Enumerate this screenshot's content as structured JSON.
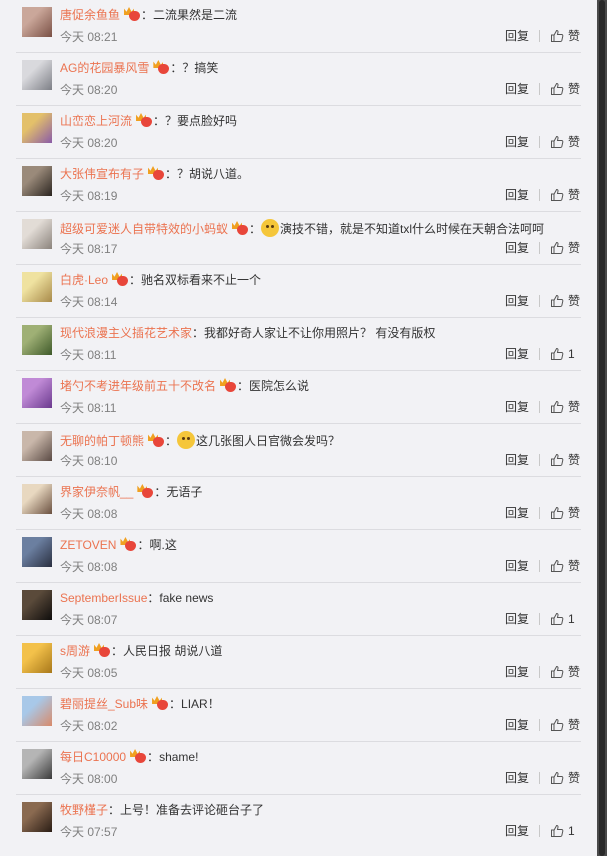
{
  "ui": {
    "colors": {
      "username": "#eb7350",
      "time": "#808080",
      "panel_bg": "#f2f2f5",
      "divider": "#dcdce0"
    }
  },
  "comments": [
    {
      "user": "唐促余鱼鱼",
      "vip": true,
      "emoji": false,
      "text": "二流果然是二流",
      "time": "今天 08:21",
      "reply": "回复",
      "like": "赞",
      "avatar": [
        "#caa79a",
        "#7a5045"
      ]
    },
    {
      "user": "AG的花园暴风雪",
      "vip": true,
      "emoji": false,
      "text": "？搞笑",
      "time": "今天 08:20",
      "reply": "回复",
      "like": "赞",
      "avatar": [
        "#d9d9dd",
        "#7d7f86"
      ]
    },
    {
      "user": "山峦恋上河流",
      "vip": true,
      "emoji": false,
      "text": "？要点脸好吗",
      "time": "今天 08:20",
      "reply": "回复",
      "like": "赞",
      "avatar": [
        "#e3c06a",
        "#8a5ba8"
      ]
    },
    {
      "user": "大张伟宣布有子",
      "vip": true,
      "emoji": false,
      "text": "？胡说八道。",
      "time": "今天 08:19",
      "reply": "回复",
      "like": "赞",
      "avatar": [
        "#9a8a7a",
        "#2b2520"
      ]
    },
    {
      "user": "超级可爱迷人自带特效的小蚂蚁",
      "vip": true,
      "emoji": true,
      "text": "演技不错，就是不知道txl什么时候在天朝合法呵呵",
      "time": "今天 08:17",
      "reply": "回复",
      "like": "赞",
      "avatar": [
        "#e2dcd6",
        "#8b837c"
      ]
    },
    {
      "user": "白虎·Leo",
      "vip": true,
      "emoji": false,
      "text": "驰名双标看来不止一个",
      "time": "今天 08:14",
      "reply": "回复",
      "like": "赞",
      "avatar": [
        "#efe2a0",
        "#a88a4a"
      ]
    },
    {
      "user": "现代浪漫主义插花艺术家",
      "vip": false,
      "emoji": false,
      "text": "我都好奇人家让不让你用照片？ 有没有版权",
      "time": "今天 08:11",
      "reply": "回复",
      "like": "1",
      "avatar": [
        "#9fb075",
        "#3f5a2a"
      ]
    },
    {
      "user": "堵勺不考进年级前五十不改名",
      "vip": true,
      "emoji": false,
      "text": "医院怎么说",
      "time": "今天 08:11",
      "reply": "回复",
      "like": "赞",
      "avatar": [
        "#c08ad6",
        "#6b3a8e"
      ]
    },
    {
      "user": "无聊的帕丁顿熊",
      "vip": true,
      "emoji": true,
      "text": "这几张图人日官微会发吗？",
      "time": "今天 08:10",
      "reply": "回复",
      "like": "赞",
      "avatar": [
        "#c9b7aa",
        "#5a4a44"
      ]
    },
    {
      "user": "界家伊奈帆__",
      "vip": true,
      "emoji": false,
      "text": "无语子",
      "time": "今天 08:08",
      "reply": "回复",
      "like": "赞",
      "avatar": [
        "#e8d8c0",
        "#6a5040"
      ]
    },
    {
      "user": "ZETOVEN",
      "vip": true,
      "emoji": false,
      "text": "啊.这",
      "time": "今天 08:08",
      "reply": "回复",
      "like": "赞",
      "avatar": [
        "#6b7fa0",
        "#2a2f40"
      ]
    },
    {
      "user": "SeptemberIssue",
      "vip": false,
      "emoji": false,
      "text": "fake news",
      "time": "今天 08:07",
      "reply": "回复",
      "like": "1",
      "avatar": [
        "#5a4a3a",
        "#0f0d0c"
      ]
    },
    {
      "user": "s周游",
      "vip": true,
      "emoji": false,
      "text": "人民日报 胡说八道",
      "time": "今天 08:05",
      "reply": "回复",
      "like": "赞",
      "avatar": [
        "#f3c14a",
        "#a8781a"
      ]
    },
    {
      "user": "碧丽提丝_Sub味",
      "vip": true,
      "emoji": false,
      "text": "LIAR！",
      "time": "今天 08:02",
      "reply": "回复",
      "like": "赞",
      "avatar": [
        "#a8c8e8",
        "#d88a6a"
      ]
    },
    {
      "user": "每日C10000",
      "vip": true,
      "emoji": false,
      "text": "shame!",
      "time": "今天 08:00",
      "reply": "回复",
      "like": "赞",
      "avatar": [
        "#b5b5b5",
        "#3a3a3a"
      ]
    },
    {
      "user": "牧野槿子",
      "vip": false,
      "emoji": false,
      "text": "上号！准备去评论砸台子了",
      "time": "今天 07:57",
      "reply": "回复",
      "like": "1",
      "avatar": [
        "#8a6a50",
        "#2a1d15"
      ]
    }
  ]
}
